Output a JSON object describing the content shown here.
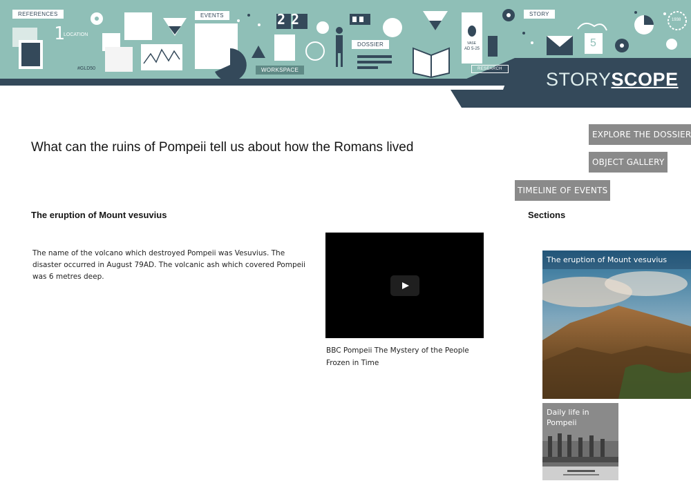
{
  "banner": {
    "tags": {
      "references": "REFERENCES",
      "events": "EVENTS",
      "workspace": "WORKSPACE",
      "dossier": "DOSSIER",
      "story": "STORY",
      "research": "RESEARCH"
    },
    "location_number": "1",
    "location_label": "LOCATION",
    "counter": "22",
    "small_tag": "#GLD50",
    "vase_label": "VASE",
    "vase_date": "AD 5-25",
    "calendar_num": "5",
    "stamp_year": "1938",
    "logo": {
      "part1": "STORY",
      "part2": "SCOPE"
    },
    "colors": {
      "teal": "#8fbfb7",
      "navy": "#34495a",
      "light": "#dfeeed"
    }
  },
  "nav": {
    "explore": "EXPLORE THE DOSSIER",
    "gallery": "OBJECT GALLERY",
    "timeline": "TIMELINE OF EVENTS",
    "color": "#8a8a8a"
  },
  "page": {
    "title": "What can the ruins of Pompeii tell us about how the Romans lived"
  },
  "section": {
    "heading": "The eruption of Mount vesuvius",
    "body": "The name of the volcano which destroyed Pompeii was Vesuvius. The disaster occurred in August 79AD. The volcanic ash which covered Pompeii was 6 metres deep."
  },
  "video": {
    "caption": "BBC Pompeii The Mystery of the People Frozen in Time"
  },
  "sidebar": {
    "heading": "Sections",
    "items": [
      {
        "label": "The eruption of Mount vesuvius"
      },
      {
        "label": "Daily life in Pompeii"
      }
    ]
  }
}
